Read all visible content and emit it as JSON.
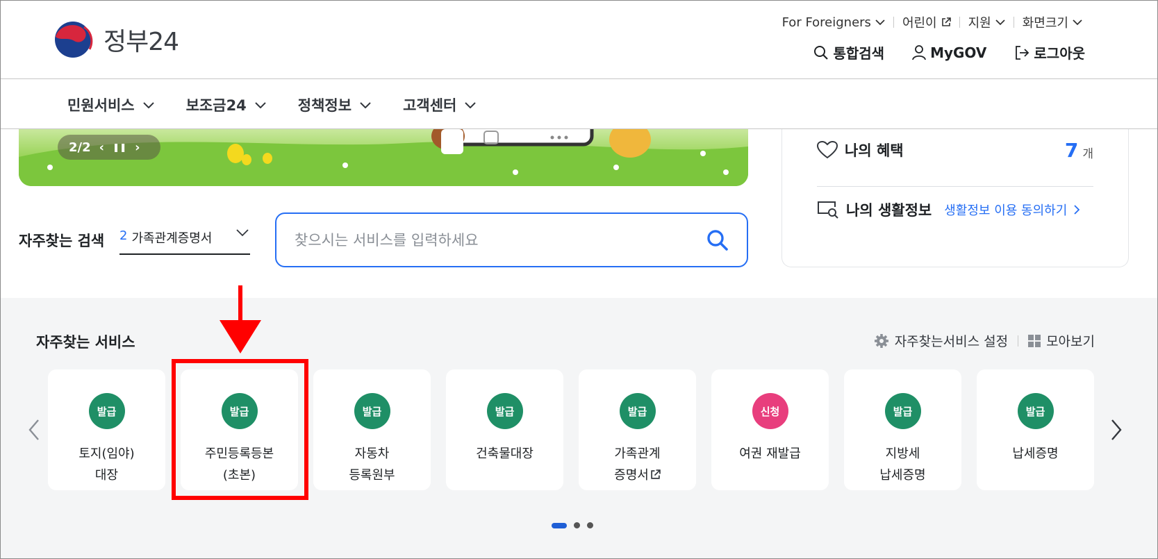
{
  "header": {
    "logo_text": "정부24",
    "util_links": [
      {
        "label": "For Foreigners",
        "icon": "chevron-down-icon"
      },
      {
        "label": "어린이",
        "icon": "external-link-icon"
      },
      {
        "label": "지원",
        "icon": "chevron-down-icon"
      },
      {
        "label": "화면크기",
        "icon": "chevron-down-icon"
      }
    ],
    "main_links": [
      {
        "label": "통합검색",
        "icon": "search-icon"
      },
      {
        "label": "MyGOV",
        "icon": "user-icon"
      },
      {
        "label": "로그아웃",
        "icon": "logout-icon"
      }
    ]
  },
  "nav": {
    "items": [
      "민원서비스",
      "보조금24",
      "정책정보",
      "고객센터"
    ]
  },
  "banner": {
    "counter": "2/2"
  },
  "side_panel": {
    "benefits_label": "나의 혜택",
    "benefits_count": "7",
    "benefits_unit": "개",
    "life_info_label": "나의 생활정보",
    "life_info_link": "생활정보 이용 동의하기"
  },
  "search": {
    "freq_label": "자주찾는 검색",
    "freq_rank": "2",
    "freq_term": "가족관계증명서",
    "placeholder": "찾으시는 서비스를 입력하세요"
  },
  "services": {
    "title": "자주찾는 서비스",
    "settings_label": "자주찾는서비스 설정",
    "grid_label": "모아보기",
    "cards": [
      {
        "badge": "발급",
        "label": "토지(임야)\n대장"
      },
      {
        "badge": "발급",
        "label": "주민등록등본\n(초본)"
      },
      {
        "badge": "발급",
        "label": "자동차\n등록원부"
      },
      {
        "badge": "발급",
        "label": "건축물대장"
      },
      {
        "badge": "발급",
        "label": "가족관계\n증명서"
      },
      {
        "badge": "신청",
        "label": "여권 재발급"
      },
      {
        "badge": "발급",
        "label": "지방세\n납세증명"
      },
      {
        "badge": "발급",
        "label": "납세증명"
      }
    ]
  },
  "colors": {
    "accent": "#256ef4",
    "badge_green": "#1f8f66",
    "badge_pink": "#e83e7d",
    "annotation_red": "#ff0000"
  }
}
